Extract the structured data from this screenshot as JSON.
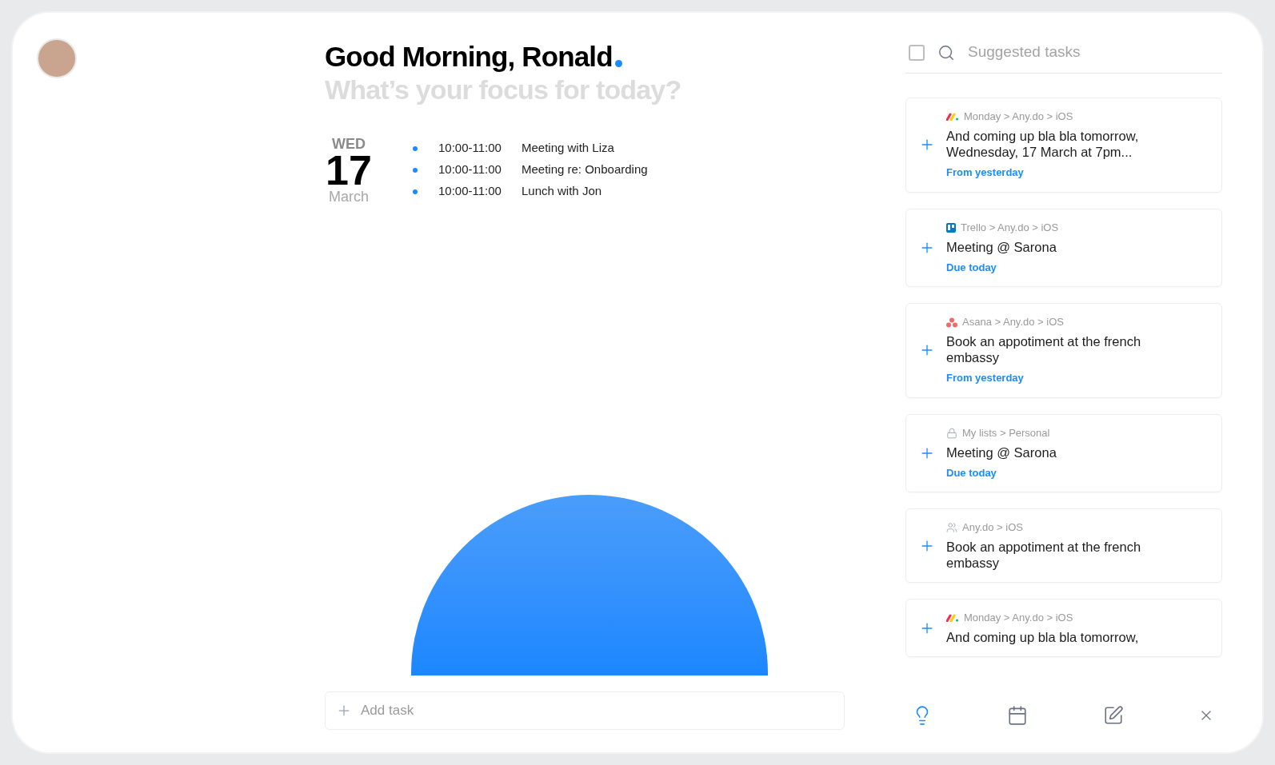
{
  "greeting": {
    "title": "Good Morning, Ronald",
    "subtitle": "What’s your focus for today?"
  },
  "date": {
    "weekday": "WED",
    "day": "17",
    "month": "March"
  },
  "events": [
    {
      "time": "10:00-11:00",
      "title": "Meeting with Liza"
    },
    {
      "time": "10:00-11:00",
      "title": "Meeting re: Onboarding"
    },
    {
      "time": "10:00-11:00",
      "title": "Lunch with Jon"
    }
  ],
  "add_task": {
    "placeholder": "Add task"
  },
  "suggestions": {
    "placeholder": "Suggested tasks",
    "checked": false
  },
  "cards": [
    {
      "kind": "monday",
      "path": "Monday > Any.do > iOS",
      "title": "And coming up bla bla tomorrow, Wednesday, 17 March at 7pm...",
      "note": "From yesterday"
    },
    {
      "kind": "trello",
      "path": "Trello > Any.do > iOS",
      "title": "Meeting @ Sarona",
      "note": "Due today"
    },
    {
      "kind": "asana",
      "path": "Asana > Any.do > iOS",
      "title": "Book an appotiment at the french embassy",
      "note": "From yesterday"
    },
    {
      "kind": "lock",
      "path": "My lists > Personal",
      "title": "Meeting @ Sarona",
      "note": "Due today"
    },
    {
      "kind": "people",
      "path": "Any.do > iOS",
      "title": "Book an appotiment at the french embassy"
    },
    {
      "kind": "monday",
      "path": "Monday > Any.do > iOS",
      "title": "And coming up bla bla tomorrow,"
    }
  ],
  "toolbar": [
    {
      "kind": "bulb",
      "selected": true
    },
    {
      "kind": "calendar",
      "selected": false
    },
    {
      "kind": "edit",
      "selected": false
    },
    {
      "kind": "close",
      "selected": false
    }
  ]
}
